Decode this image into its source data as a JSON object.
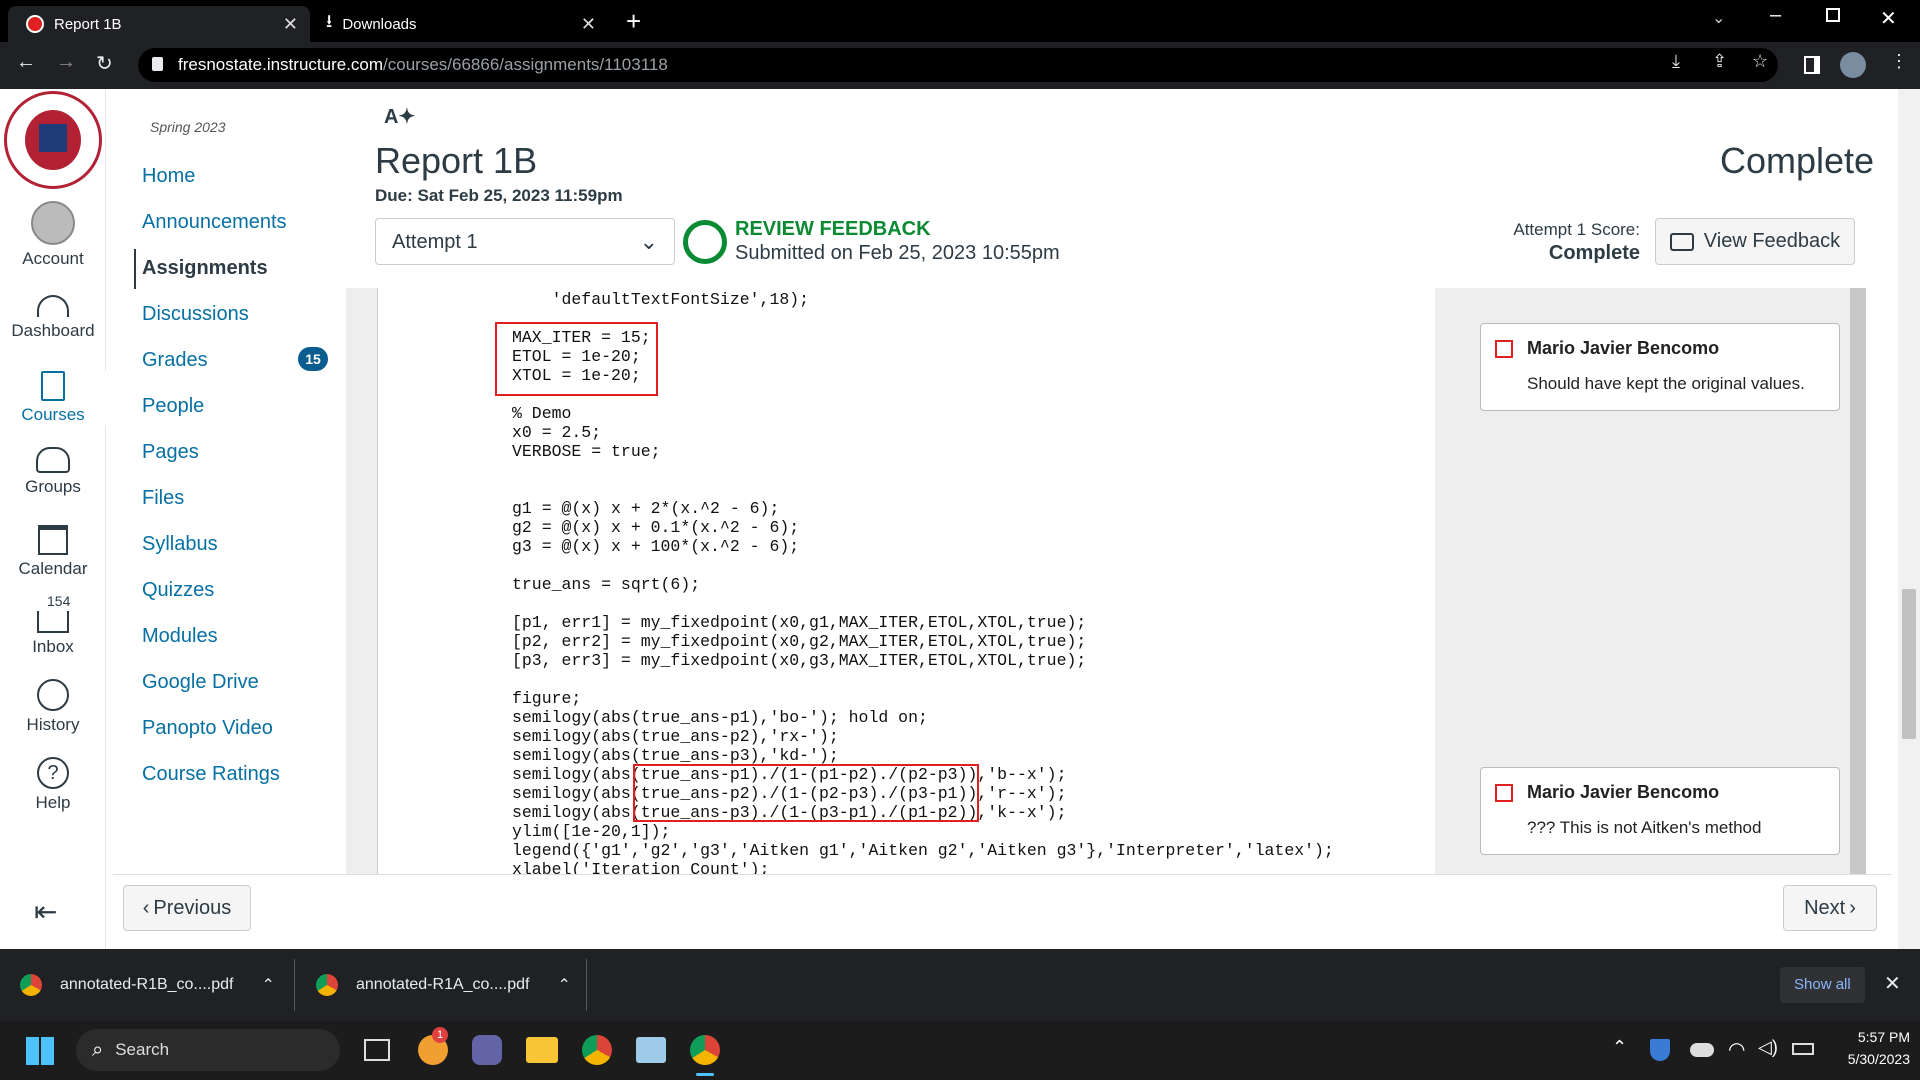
{
  "browser": {
    "tabs": [
      {
        "title": "Report 1B"
      },
      {
        "title": "Downloads"
      }
    ],
    "url_host": "fresnostate.instructure.com",
    "url_path": "/courses/66866/assignments/1103118"
  },
  "global_nav": {
    "account": "Account",
    "dashboard": "Dashboard",
    "courses": "Courses",
    "groups": "Groups",
    "calendar": "Calendar",
    "inbox": "Inbox",
    "inbox_badge": "154",
    "history": "History",
    "help": "Help"
  },
  "course_nav": {
    "term": "Spring 2023",
    "items": [
      "Home",
      "Announcements",
      "Assignments",
      "Discussions",
      "Grades",
      "People",
      "Pages",
      "Files",
      "Syllabus",
      "Quizzes",
      "Modules",
      "Google Drive",
      "Panopto Video",
      "Course Ratings"
    ],
    "grades_badge": "15"
  },
  "assignment": {
    "title": "Report 1B",
    "status": "Complete",
    "due": "Due: Sat Feb 25, 2023 11:59pm",
    "attempt_select": "Attempt 1",
    "review_label": "REVIEW FEEDBACK",
    "submitted": "Submitted on Feb 25, 2023 10:55pm",
    "score_label": "Attempt 1 Score:",
    "score_value": "Complete",
    "view_feedback": "View Feedback"
  },
  "code_lines": [
    "    'defaultTextFontSize',18);",
    "",
    "MAX_ITER = 15;",
    "ETOL = 1e-20;",
    "XTOL = 1e-20;",
    "",
    "% Demo",
    "x0 = 2.5;",
    "VERBOSE = true;",
    "",
    "",
    "g1 = @(x) x + 2*(x.^2 - 6);",
    "g2 = @(x) x + 0.1*(x.^2 - 6);",
    "g3 = @(x) x + 100*(x.^2 - 6);",
    "",
    "true_ans = sqrt(6);",
    "",
    "[p1, err1] = my_fixedpoint(x0,g1,MAX_ITER,ETOL,XTOL,true);",
    "[p2, err2] = my_fixedpoint(x0,g2,MAX_ITER,ETOL,XTOL,true);",
    "[p3, err3] = my_fixedpoint(x0,g3,MAX_ITER,ETOL,XTOL,true);",
    "",
    "figure;",
    "semilogy(abs(true_ans-p1),'bo-'); hold on;",
    "semilogy(abs(true_ans-p2),'rx-');",
    "semilogy(abs(true_ans-p3),'kd-');",
    "semilogy(abs(true_ans-p1)./(1-(p1-p2)./(p2-p3)),'b--x');",
    "semilogy(abs(true_ans-p2)./(1-(p2-p3)./(p3-p1)),'r--x');",
    "semilogy(abs(true_ans-p3)./(1-(p3-p1)./(p1-p2)),'k--x');",
    "ylim([1e-20,1]);",
    "legend({'g1','g2','g3','Aitken g1','Aitken g2','Aitken g3'},'Interpreter','latex');",
    "xlabel('Iteration Count');"
  ],
  "feedback": [
    {
      "author": "Mario Javier Bencomo",
      "text": "Should have kept the original values."
    },
    {
      "author": "Mario Javier Bencomo",
      "text": "??? This is not Aitken's method"
    }
  ],
  "footer": {
    "previous": "Previous",
    "next": "Next"
  },
  "downloads": {
    "items": [
      "annotated-R1B_co....pdf",
      "annotated-R1A_co....pdf"
    ],
    "show_all": "Show all"
  },
  "taskbar": {
    "search": "Search",
    "time": "5:57 PM",
    "date": "5/30/2023",
    "chat_badge": "1"
  }
}
